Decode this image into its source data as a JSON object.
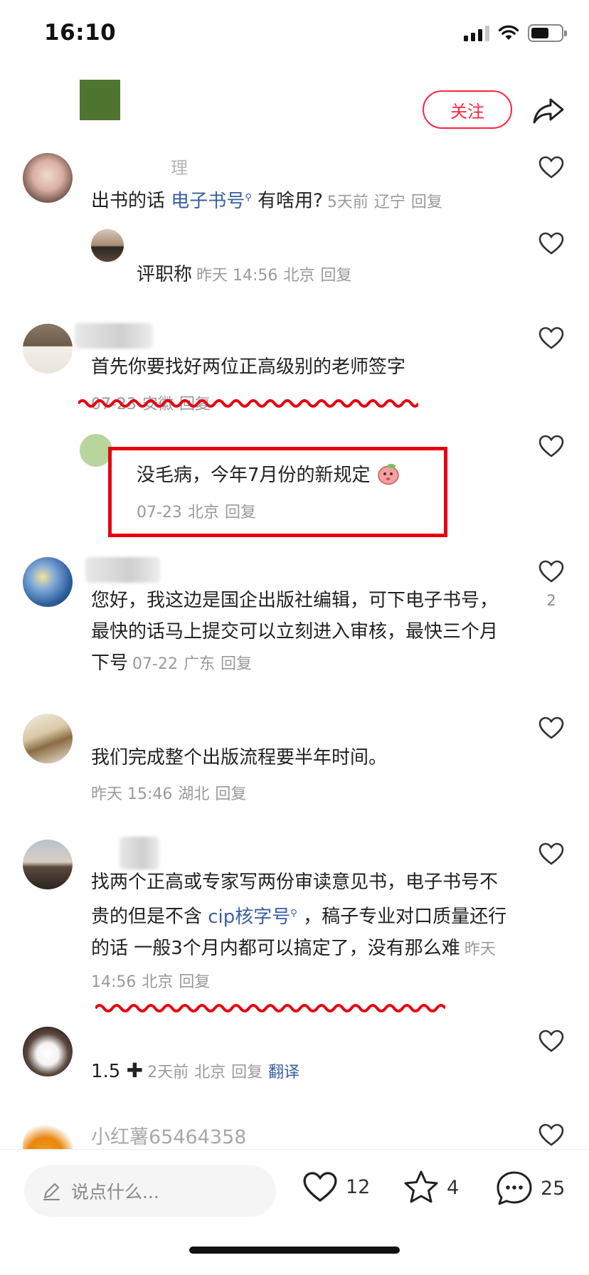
{
  "status_bar": {
    "time": "16:10"
  },
  "header": {
    "follow_label": "关注"
  },
  "comments": [
    {
      "username": "理",
      "text_before": "出书的话 ",
      "link": "电子书号",
      "text_after": " 有啥用?",
      "meta": {
        "time": "5天前",
        "location": "辽宁",
        "reply": "回复"
      }
    },
    {
      "text": "评职称",
      "meta": {
        "time": "昨天 14:56",
        "location": "北京",
        "reply": "回复"
      }
    },
    {
      "text": "首先你要找好两位正高级别的老师签字",
      "meta": {
        "time": "07-23",
        "location": "安徽",
        "reply": "回复"
      }
    },
    {
      "text": "没毛病，今年7月份的新规定",
      "meta": {
        "time": "07-23",
        "location": "北京",
        "reply": "回复"
      }
    },
    {
      "text": "您好，我这边是国企出版社编辑，可下电子书号，最快的话马上提交可以立刻进入审核，最快三个月下号",
      "like_count": "2",
      "meta": {
        "time": "07-22",
        "location": "广东",
        "reply": "回复"
      }
    },
    {
      "text": "我们完成整个出版流程要半年时间。",
      "meta": {
        "time": "昨天 15:46",
        "location": "湖北",
        "reply": "回复"
      }
    },
    {
      "text_before": "找两个正高或专家写两份审读意见书，电子书号不贵的但是不含 ",
      "link": "cip核字号",
      "text_after": " ，稿子专业对口质量还行的话 一般3个月内都可以搞定了，没有那么难",
      "meta": {
        "time": "昨天 14:56",
        "location": "北京",
        "reply": "回复"
      }
    },
    {
      "text": "1.5",
      "meta": {
        "time": "2天前",
        "location": "北京",
        "reply": "回复",
        "translate": "翻译"
      }
    },
    {
      "username": "小红薯65464358"
    }
  ],
  "bottom_bar": {
    "input_placeholder": "说点什么...",
    "likes": "12",
    "favorites": "4",
    "comments": "25"
  },
  "colors": {
    "accent": "#ff2442",
    "link": "#3a5fa0",
    "annotation": "#e60012"
  }
}
